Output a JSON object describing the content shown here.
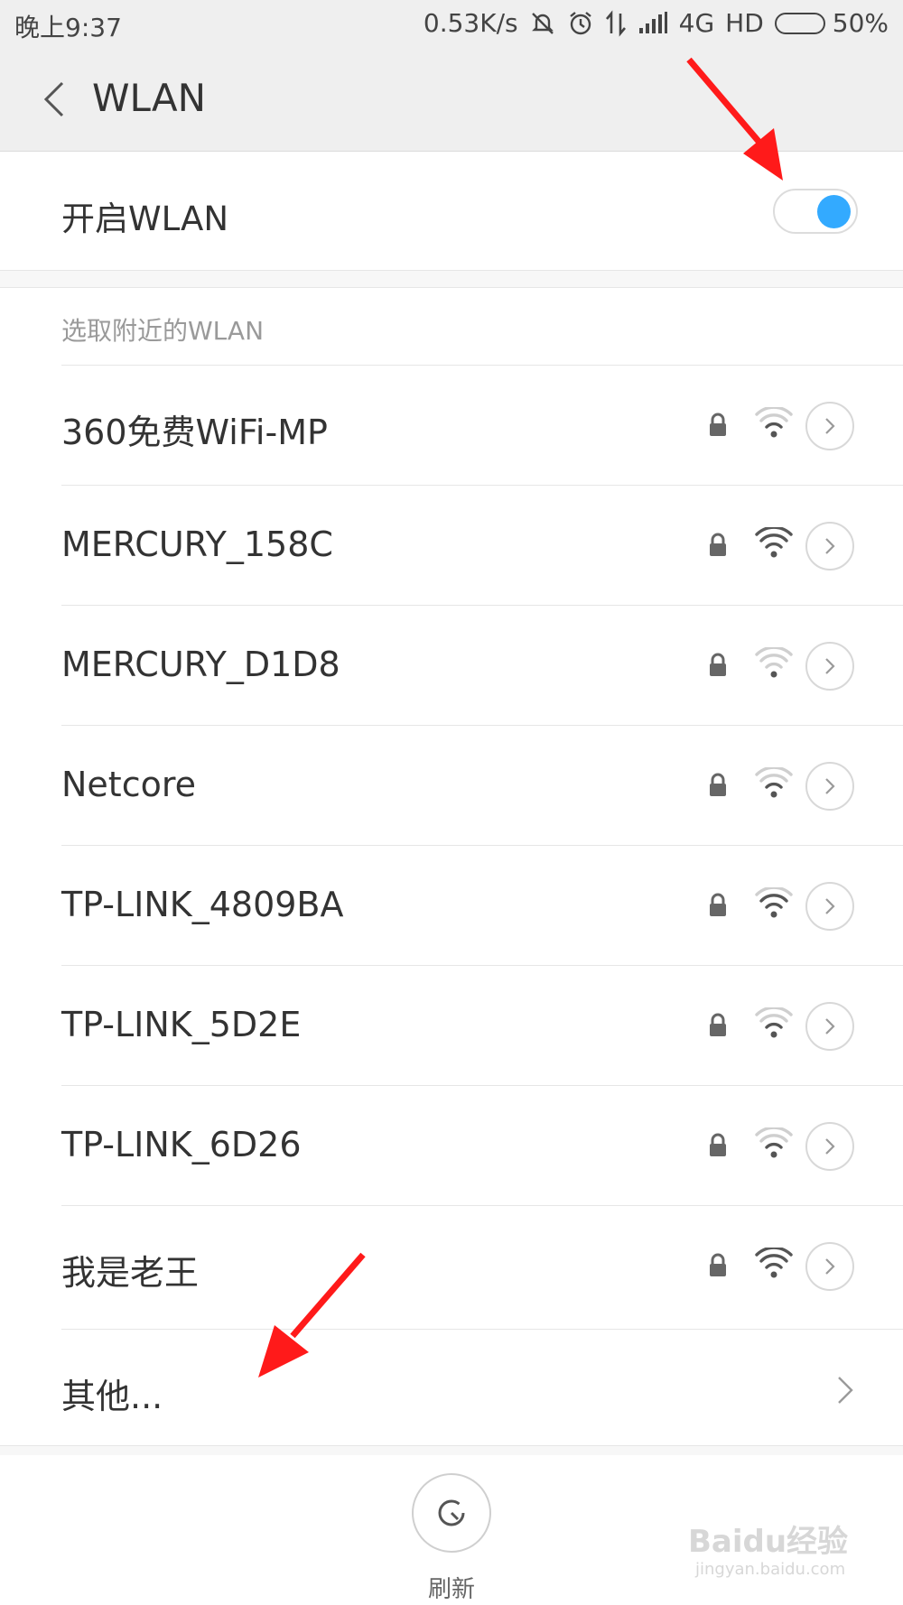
{
  "status_bar": {
    "time": "晚上9:37",
    "net_speed": "0.53K/s",
    "network": "4G",
    "hd": "HD",
    "battery": "50%",
    "battery_level": 0.5,
    "icons": [
      "silent-bell-icon",
      "alarm-icon",
      "data-transfer-icon",
      "signal-icon"
    ]
  },
  "header": {
    "title": "WLAN",
    "back_icon": "back-chevron-icon"
  },
  "wlan_toggle": {
    "label": "开启WLAN",
    "enabled": true,
    "accent": "#33aaff"
  },
  "networks": {
    "section_title": "选取附近的WLAN",
    "items": [
      {
        "ssid": "360免费WiFi-MP",
        "locked": true,
        "signal_level": 0.6
      },
      {
        "ssid": "MERCURY_158C",
        "locked": true,
        "signal_level": 1.0
      },
      {
        "ssid": "MERCURY_D1D8",
        "locked": true,
        "signal_level": 0.3
      },
      {
        "ssid": "Netcore",
        "locked": true,
        "signal_level": 0.6
      },
      {
        "ssid": "TP-LINK_4809BA",
        "locked": true,
        "signal_level": 0.8
      },
      {
        "ssid": "TP-LINK_5D2E",
        "locked": true,
        "signal_level": 0.6
      },
      {
        "ssid": "TP-LINK_6D26",
        "locked": true,
        "signal_level": 0.6
      },
      {
        "ssid": "我是老王",
        "locked": true,
        "signal_level": 1.0
      }
    ],
    "other_label": "其他..."
  },
  "footer": {
    "refresh_label": "刷新"
  },
  "watermark": {
    "text": "Baidu经验",
    "sub": "jingyan.baidu.com"
  },
  "annotation_color": "#ff1a1a"
}
